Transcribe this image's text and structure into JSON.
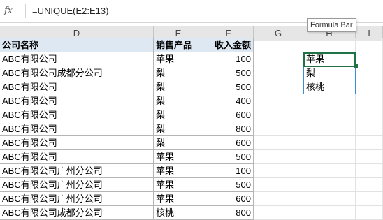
{
  "formula_bar": {
    "fx_label": "fx",
    "formula": "=UNIQUE(E2:E13)"
  },
  "columns": [
    "D",
    "E",
    "F",
    "G",
    "H",
    "I"
  ],
  "tooltip": "Formula Bar",
  "table": {
    "headers": [
      "公司名称",
      "销售产品",
      "收入金额"
    ],
    "rows": [
      [
        "ABC有限公司",
        "苹果",
        "100"
      ],
      [
        "ABC有限公司成都分公司",
        "梨",
        "500"
      ],
      [
        "ABC有限公司",
        "梨",
        "500"
      ],
      [
        "ABC有限公司",
        "梨",
        "400"
      ],
      [
        "ABC有限公司",
        "梨",
        "600"
      ],
      [
        "ABC有限公司",
        "梨",
        "800"
      ],
      [
        "ABC有限公司",
        "梨",
        "600"
      ],
      [
        "ABC有限公司",
        "苹果",
        "500"
      ],
      [
        "ABC有限公司广州分公司",
        "苹果",
        "100"
      ],
      [
        "ABC有限公司广州分公司",
        "苹果",
        "500"
      ],
      [
        "ABC有限公司广州分公司",
        "苹果",
        "600"
      ],
      [
        "ABC有限公司成都分公司",
        "核桃",
        "800"
      ]
    ]
  },
  "unique_result": [
    "苹果",
    "梨",
    "核桃"
  ]
}
